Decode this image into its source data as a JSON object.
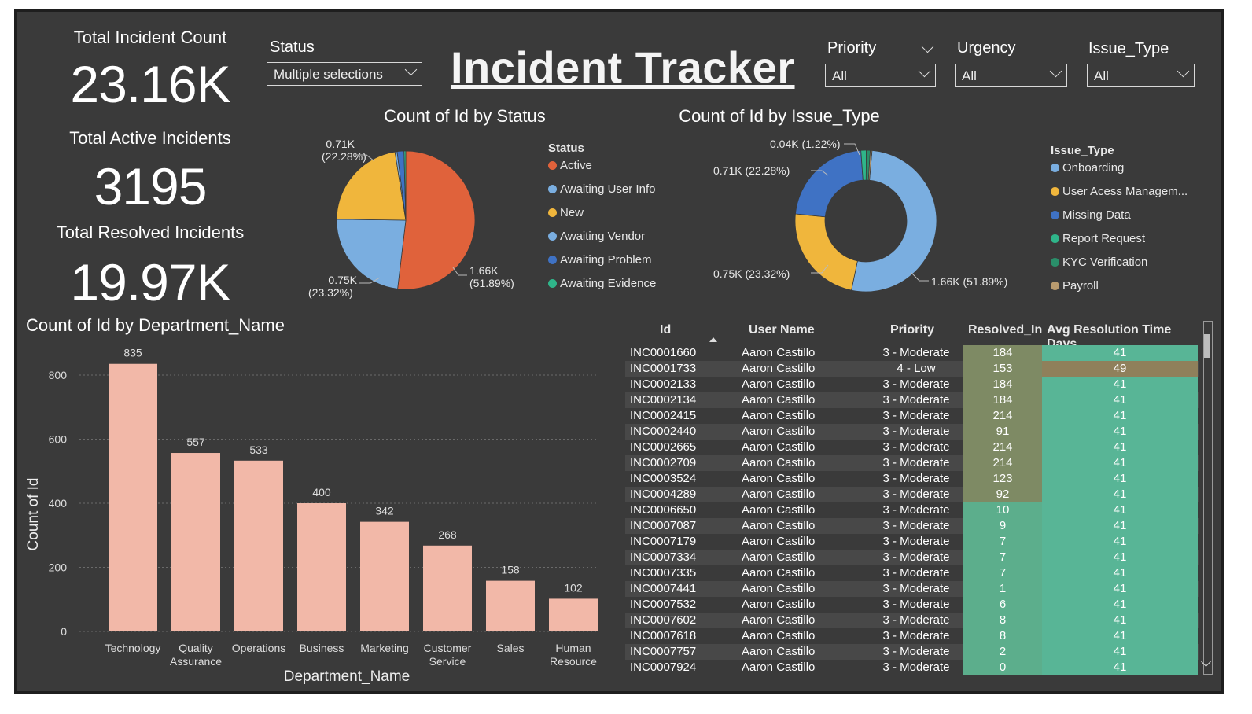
{
  "title": "Incident Tracker",
  "kpis": {
    "total_label": "Total Incident Count",
    "total_value": "23.16K",
    "active_label": "Total Active Incidents",
    "active_value": "3195",
    "resolved_label": "Total Resolved Incidents",
    "resolved_value": "19.97K"
  },
  "slicers": {
    "status": {
      "label": "Status",
      "value": "Multiple selections"
    },
    "priority": {
      "label": "Priority",
      "value": "All"
    },
    "urgency": {
      "label": "Urgency",
      "value": "All"
    },
    "issue_type": {
      "label": "Issue_Type",
      "value": "All"
    }
  },
  "status_pie": {
    "title": "Count of Id by Status",
    "legend_title": "Status",
    "legend": [
      {
        "name": "Active",
        "color": "#e0623b"
      },
      {
        "name": "Awaiting User Info",
        "color": "#7aaee0"
      },
      {
        "name": "New",
        "color": "#f0b63c"
      },
      {
        "name": "Awaiting Vendor",
        "color": "#7aaee0"
      },
      {
        "name": "Awaiting Problem",
        "color": "#3f72c4"
      },
      {
        "name": "Awaiting Evidence",
        "color": "#2fb58a"
      }
    ],
    "labels": {
      "a": "0.71K",
      "a2": "(22.28%)",
      "b": "0.75K",
      "b2": "(23.32%)",
      "c": "1.66K",
      "c2": "(51.89%)"
    }
  },
  "issue_donut": {
    "title": "Count of Id by Issue_Type",
    "legend_title": "Issue_Type",
    "legend": [
      {
        "name": "Onboarding",
        "color": "#7aaee0"
      },
      {
        "name": "User Acess Managem...",
        "color": "#f0b63c"
      },
      {
        "name": "Missing Data",
        "color": "#3f72c4"
      },
      {
        "name": "Report Request",
        "color": "#2fb58a"
      },
      {
        "name": "KYC Verification",
        "color": "#2a8f6a"
      },
      {
        "name": "Payroll",
        "color": "#b89a6e"
      }
    ],
    "labels": {
      "a": "0.04K (1.22%)",
      "b": "0.71K (22.28%)",
      "c": "0.75K (23.32%)",
      "d": "1.66K (51.89%)"
    }
  },
  "chart_data": [
    {
      "type": "pie",
      "title": "Count of Id by Status",
      "categories": [
        "Active",
        "Awaiting User Info",
        "New",
        "Awaiting Vendor",
        "Awaiting Problem",
        "Awaiting Evidence"
      ],
      "values": [
        51.89,
        23.32,
        22.28,
        0.5,
        1.6,
        0.41
      ],
      "colors": [
        "#e0623b",
        "#7aaee0",
        "#f0b63c",
        "#7aaee0",
        "#3f72c4",
        "#2fb58a"
      ]
    },
    {
      "type": "pie",
      "title": "Count of Id by Issue_Type",
      "categories": [
        "Onboarding",
        "User Acess Managem...",
        "Missing Data",
        "Report Request",
        "KYC Verification",
        "Payroll"
      ],
      "values": [
        51.89,
        23.32,
        22.28,
        1.22,
        0.9,
        0.39
      ],
      "colors": [
        "#7aaee0",
        "#f0b63c",
        "#3f72c4",
        "#2fb58a",
        "#2a8f6a",
        "#b89a6e"
      ]
    },
    {
      "type": "bar",
      "title": "Count of Id by Department_Name",
      "xlabel": "Department_Name",
      "ylabel": "Count of Id",
      "categories": [
        "Technology",
        "Quality Assurance",
        "Operations",
        "Business",
        "Marketing",
        "Customer Service",
        "Sales",
        "Human Resource"
      ],
      "values": [
        835,
        557,
        533,
        400,
        342,
        268,
        158,
        102
      ],
      "ylim": [
        0,
        800
      ],
      "yticks": [
        0,
        200,
        400,
        600,
        800
      ],
      "color": "#f2b8a8",
      "grid": true
    }
  ],
  "table": {
    "headers": [
      "Id",
      "User Name",
      "Priority",
      "Resolved_In",
      "Avg Resolution Time Days"
    ],
    "rows": [
      [
        "INC0001660",
        "Aaron Castillo",
        "3 - Moderate",
        "184",
        "41"
      ],
      [
        "INC0001733",
        "Aaron Castillo",
        "4 - Low",
        "153",
        "49"
      ],
      [
        "INC0002133",
        "Aaron Castillo",
        "3 - Moderate",
        "184",
        "41"
      ],
      [
        "INC0002134",
        "Aaron Castillo",
        "3 - Moderate",
        "184",
        "41"
      ],
      [
        "INC0002415",
        "Aaron Castillo",
        "3 - Moderate",
        "214",
        "41"
      ],
      [
        "INC0002440",
        "Aaron Castillo",
        "3 - Moderate",
        "91",
        "41"
      ],
      [
        "INC0002665",
        "Aaron Castillo",
        "3 - Moderate",
        "214",
        "41"
      ],
      [
        "INC0002709",
        "Aaron Castillo",
        "3 - Moderate",
        "214",
        "41"
      ],
      [
        "INC0003524",
        "Aaron Castillo",
        "3 - Moderate",
        "123",
        "41"
      ],
      [
        "INC0004289",
        "Aaron Castillo",
        "3 - Moderate",
        "92",
        "41"
      ],
      [
        "INC0006650",
        "Aaron Castillo",
        "3 - Moderate",
        "10",
        "41"
      ],
      [
        "INC0007087",
        "Aaron Castillo",
        "3 - Moderate",
        "9",
        "41"
      ],
      [
        "INC0007179",
        "Aaron Castillo",
        "3 - Moderate",
        "7",
        "41"
      ],
      [
        "INC0007334",
        "Aaron Castillo",
        "3 - Moderate",
        "7",
        "41"
      ],
      [
        "INC0007335",
        "Aaron Castillo",
        "3 - Moderate",
        "7",
        "41"
      ],
      [
        "INC0007441",
        "Aaron Castillo",
        "3 - Moderate",
        "1",
        "41"
      ],
      [
        "INC0007532",
        "Aaron Castillo",
        "3 - Moderate",
        "6",
        "41"
      ],
      [
        "INC0007602",
        "Aaron Castillo",
        "3 - Moderate",
        "8",
        "41"
      ],
      [
        "INC0007618",
        "Aaron Castillo",
        "3 - Moderate",
        "8",
        "41"
      ],
      [
        "INC0007757",
        "Aaron Castillo",
        "3 - Moderate",
        "2",
        "41"
      ],
      [
        "INC0007924",
        "Aaron Castillo",
        "3 - Moderate",
        "0",
        "41"
      ]
    ]
  },
  "colors": {
    "background": "#3a3a3a",
    "resolved_high": "#7e8a64",
    "resolved_low": "#5cae8c",
    "avg_normal": "#58b596",
    "avg_high": "#8f805b"
  }
}
